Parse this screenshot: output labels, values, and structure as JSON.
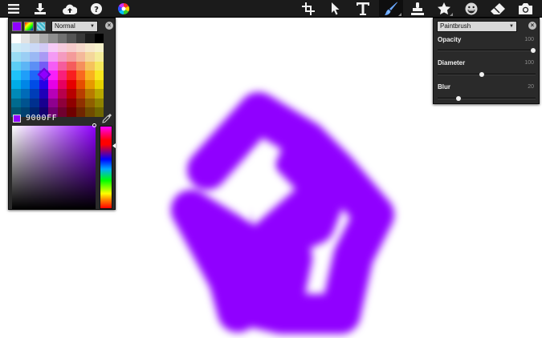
{
  "toolbar": {
    "left_icons": [
      "menu-icon",
      "download-icon",
      "cloud-upload-icon",
      "help-icon",
      "color-wheel-icon"
    ],
    "right_icons": [
      "crop-icon",
      "select-arrow-icon",
      "text-icon",
      "paintbrush-icon",
      "stamp-icon",
      "star-icon",
      "emoji-icon",
      "eraser-icon",
      "camera-icon"
    ],
    "active_tool": "paintbrush-icon"
  },
  "color_panel": {
    "blend_mode": "Normal",
    "hex_value": "9000FF",
    "selected_color": "#9000ff",
    "hue_position": 0.2
  },
  "brush_panel": {
    "brush_type": "Paintbrush",
    "sliders": [
      {
        "label": "Opacity",
        "value": "100",
        "level": 1.0
      },
      {
        "label": "Diameter",
        "value": "100",
        "level": 0.45
      },
      {
        "label": "Blur",
        "value": "20",
        "level": 0.2
      }
    ]
  },
  "canvas": {
    "stroke_color": "#9000ff"
  }
}
